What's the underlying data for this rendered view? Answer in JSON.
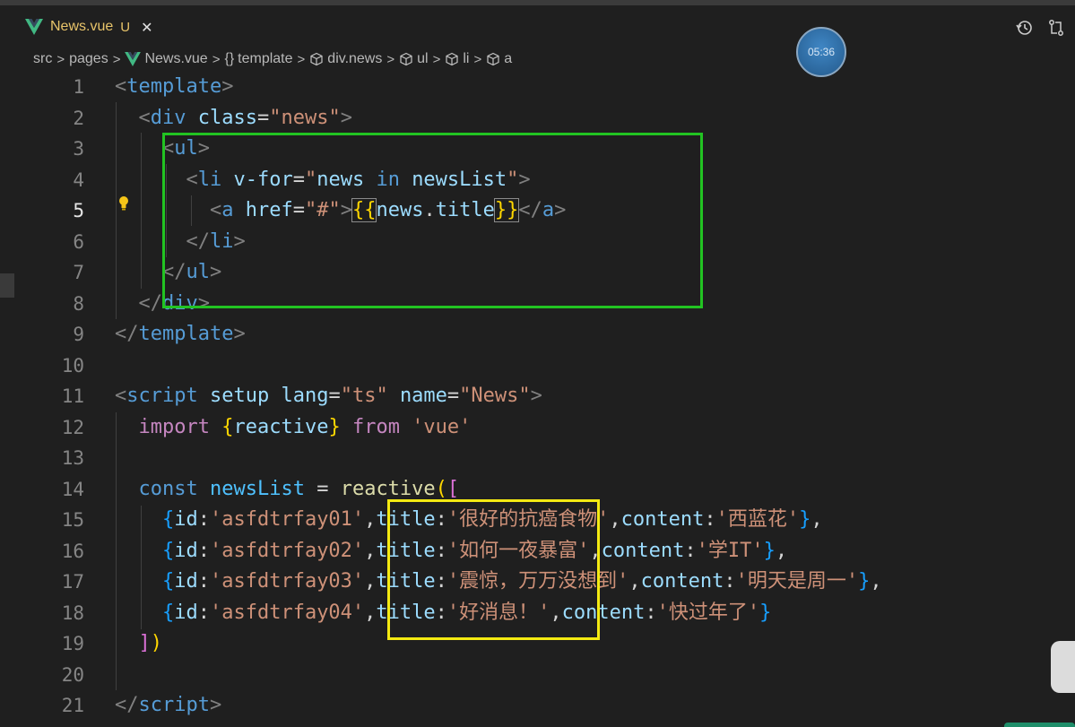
{
  "tab": {
    "filename": "News.vue",
    "status": "U",
    "close_glyph": "✕"
  },
  "breadcrumbs": [
    {
      "label": "src",
      "icon": ""
    },
    {
      "label": "pages",
      "icon": ""
    },
    {
      "label": "News.vue",
      "icon": "vue-logo-icon"
    },
    {
      "label": "template",
      "icon": "braces-icon",
      "prefix": "{}"
    },
    {
      "label": "div.news",
      "icon": "cube-icon"
    },
    {
      "label": "ul",
      "icon": "cube-icon"
    },
    {
      "label": "li",
      "icon": "cube-icon"
    },
    {
      "label": "a",
      "icon": "cube-icon"
    }
  ],
  "timer": "05:36",
  "active_line": 5,
  "colors": {
    "green_highlight": "#22c322",
    "yellow_highlight": "#f4ea12",
    "vue_green": "#41b883"
  },
  "line_numbers": [
    "1",
    "2",
    "3",
    "4",
    "5",
    "6",
    "7",
    "8",
    "9",
    "10",
    "11",
    "12",
    "13",
    "14",
    "15",
    "16",
    "17",
    "18",
    "19",
    "20",
    "21"
  ],
  "code": {
    "l1": [
      "<",
      "template",
      ">"
    ],
    "l2": [
      "  ",
      "<",
      "div",
      " ",
      "class",
      "=",
      "\"news\"",
      ">"
    ],
    "l3": [
      "    ",
      "<",
      "ul",
      ">"
    ],
    "l4": [
      "      ",
      "<",
      "li",
      " ",
      "v-for",
      "=",
      "\"",
      "news",
      " in ",
      "newsList",
      "\"",
      ">"
    ],
    "l5": [
      "        ",
      "<",
      "a",
      " ",
      "href",
      "=",
      "\"#\"",
      ">",
      "{{",
      "news",
      ".",
      "title",
      "}}",
      "</",
      "a",
      ">"
    ],
    "l6": [
      "      ",
      "</",
      "li",
      ">"
    ],
    "l7": [
      "    ",
      "</",
      "ul",
      ">"
    ],
    "l8": [
      "  ",
      "</",
      "div",
      ">"
    ],
    "l9": [
      "</",
      "template",
      ">"
    ],
    "l11": [
      "<",
      "script",
      " ",
      "setup",
      " ",
      "lang",
      "=",
      "\"ts\"",
      " ",
      "name",
      "=",
      "\"News\"",
      ">"
    ],
    "l12": [
      "  ",
      "import",
      " ",
      "{",
      "reactive",
      "}",
      " ",
      "from",
      " ",
      "'vue'"
    ],
    "l14": [
      "  ",
      "const",
      " ",
      "newsList",
      " = ",
      "reactive",
      "(",
      "["
    ],
    "l15": [
      "    ",
      "{",
      "id",
      ":",
      "'asfdtrfay01'",
      ",",
      "title",
      ":",
      "'很好的抗癌食物'",
      ",",
      "content",
      ":",
      "'西蓝花'",
      "}",
      ","
    ],
    "l16": [
      "    ",
      "{",
      "id",
      ":",
      "'asfdtrfay02'",
      ",",
      "title",
      ":",
      "'如何一夜暴富'",
      ",",
      "content",
      ":",
      "'学IT'",
      "}",
      ","
    ],
    "l17": [
      "    ",
      "{",
      "id",
      ":",
      "'asfdtrfay03'",
      ",",
      "title",
      ":",
      "'震惊，万万没想到'",
      ",",
      "content",
      ":",
      "'明天是周一'",
      "}",
      ","
    ],
    "l18": [
      "    ",
      "{",
      "id",
      ":",
      "'asfdtrfay04'",
      ",",
      "title",
      ":",
      "'好消息！'",
      ",",
      "content",
      ":",
      "'快过年了'",
      "}"
    ],
    "l19": [
      "  ",
      "]",
      ")"
    ],
    "l21": [
      "</",
      "script",
      ">"
    ]
  }
}
